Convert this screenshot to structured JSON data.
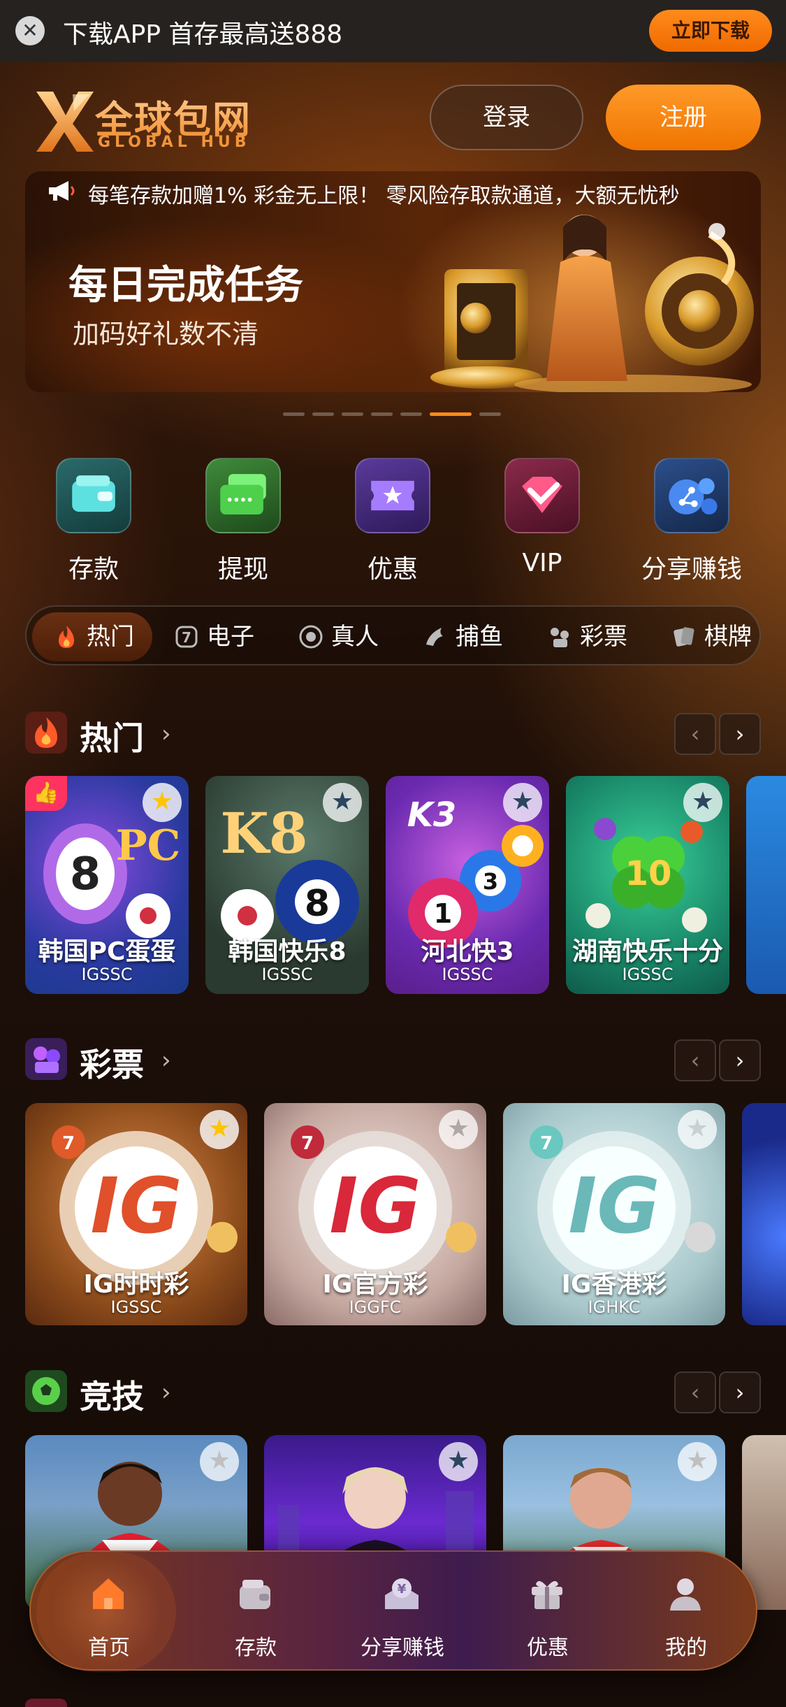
{
  "top_banner": {
    "message": "下载APP 首存最高送888",
    "download_label": "立即下载"
  },
  "header": {
    "brand_cn": "全球包网",
    "brand_en": "GLOBAL HUB",
    "login_label": "登录",
    "register_label": "注册"
  },
  "promo_banner": {
    "marquee": "每笔存款加赠1% 彩金无上限！ 零风险存取款通道，大额无忧秒",
    "title": "每日完成任务",
    "subtitle": "加码好礼数不清",
    "slide_count": 8,
    "active_slide": 6
  },
  "quick_menu": [
    {
      "label": "存款",
      "icon": "wallet-icon"
    },
    {
      "label": "提现",
      "icon": "card-icon"
    },
    {
      "label": "优惠",
      "icon": "ticket-star-icon"
    },
    {
      "label": "VIP",
      "icon": "diamond-icon"
    },
    {
      "label": "分享赚钱",
      "icon": "share-icon"
    }
  ],
  "category_tabs": [
    {
      "label": "热门",
      "icon": "fire-icon",
      "active": true
    },
    {
      "label": "电子",
      "icon": "slot-icon",
      "active": false
    },
    {
      "label": "真人",
      "icon": "chip-icon",
      "active": false
    },
    {
      "label": "捕鱼",
      "icon": "fish-icon",
      "active": false
    },
    {
      "label": "彩票",
      "icon": "lottery-icon",
      "active": false
    },
    {
      "label": "棋牌",
      "icon": "cards-icon",
      "active": false
    }
  ],
  "sections": {
    "hot": {
      "title": "热门",
      "games": [
        {
          "name": "韩国PC蛋蛋",
          "code": "IGSSC",
          "art": "PC",
          "favorite": true
        },
        {
          "name": "韩国快乐8",
          "code": "IGSSC",
          "art": "K8",
          "favorite": false
        },
        {
          "name": "河北快3",
          "code": "IGSSC",
          "art": "K3",
          "favorite": false
        },
        {
          "name": "湖南快乐十分",
          "code": "IGSSC",
          "art": "10",
          "favorite": false
        }
      ]
    },
    "lottery": {
      "title": "彩票",
      "games": [
        {
          "name": "IG时时彩",
          "code": "IGSSC",
          "art": "IG",
          "favorite": true
        },
        {
          "name": "IG官方彩",
          "code": "IGGFC",
          "art": "IG",
          "favorite": false
        },
        {
          "name": "IG香港彩",
          "code": "IGHKC",
          "art": "IG",
          "favorite": false
        }
      ]
    },
    "sports": {
      "title": "竞技"
    }
  },
  "bottom_nav": [
    {
      "label": "首页",
      "icon": "home-icon",
      "active": true
    },
    {
      "label": "存款",
      "icon": "wallet-icon",
      "active": false
    },
    {
      "label": "分享赚钱",
      "icon": "yen-gift-icon",
      "active": false
    },
    {
      "label": "优惠",
      "icon": "gift-icon",
      "active": false
    },
    {
      "label": "我的",
      "icon": "user-icon",
      "active": false
    }
  ],
  "colors": {
    "accent": "#f07a0a",
    "background": "#1d0f08"
  }
}
